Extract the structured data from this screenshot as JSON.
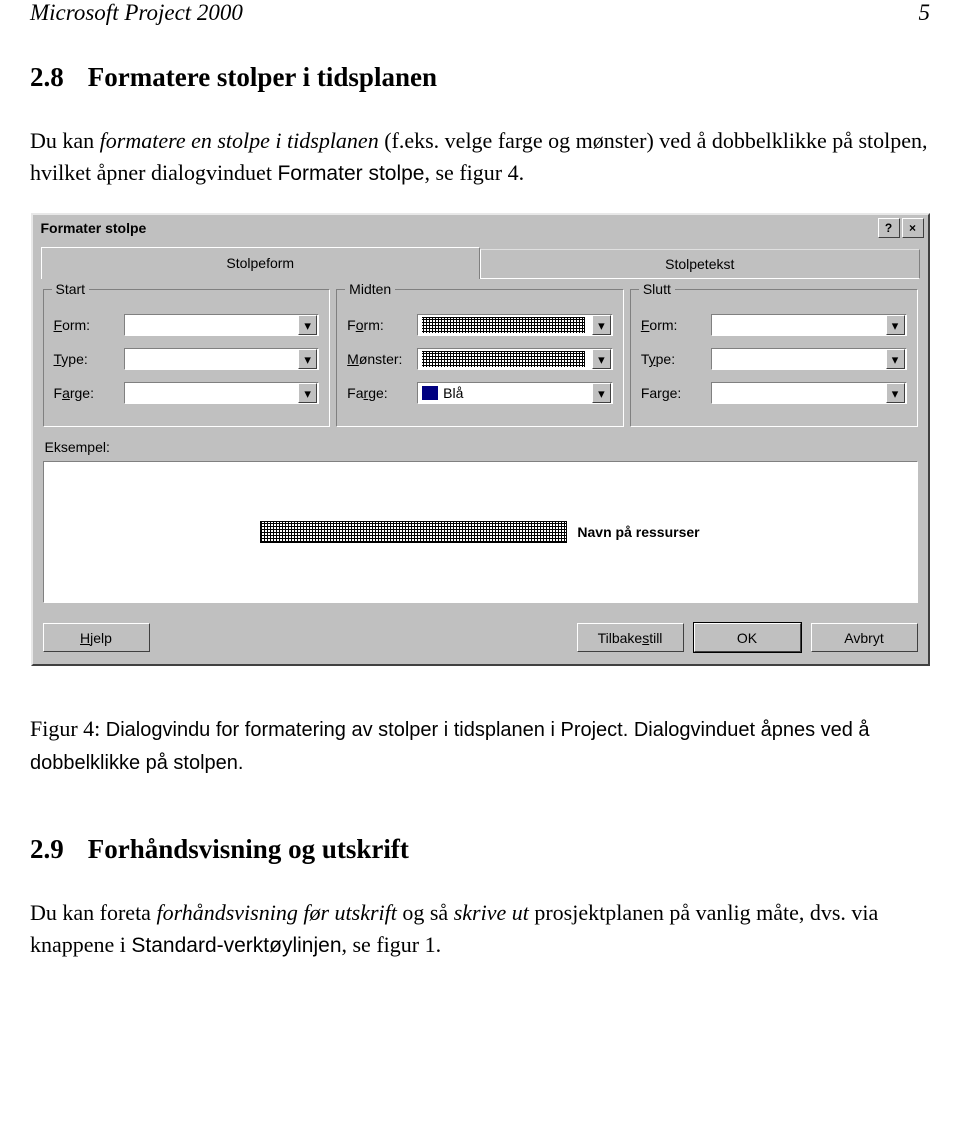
{
  "header": {
    "left": "Microsoft Project 2000",
    "right": "5"
  },
  "sec1": {
    "num": "2.8",
    "title": "Formatere stolper i tidsplanen",
    "para_a": "Du kan ",
    "para_b": "formatere en stolpe i tidsplanen",
    "para_c": " (f.eks. velge farge og mønster) ved å dobbelklikke på stolpen, hvilket åpner dialogvinduet ",
    "para_d": "Formater stolpe",
    "para_e": ", se figur 4."
  },
  "dialog": {
    "title": "Formater stolpe",
    "help": "?",
    "close": "×",
    "tab1": "Stolpeform",
    "tab2": "Stolpetekst",
    "group_start": "Start",
    "group_mid": "Midten",
    "group_end": "Slutt",
    "form": "Form:",
    "type": "Type:",
    "monster": "Mønster:",
    "farge": "Farge:",
    "farge_value": "Blå",
    "example": "Eksempel:",
    "example_text": "Navn på ressurser",
    "btn_help": "Hjelp",
    "btn_reset": "Tilbakestill",
    "btn_ok": "OK",
    "btn_cancel": "Avbryt"
  },
  "figcaption": {
    "a": "Figur 4: ",
    "b": "Dialogvindu for formatering av stolper i tidsplanen i Project. Dialogvinduet åpnes ved å dobbelklikke på stolpen."
  },
  "sec2": {
    "num": "2.9",
    "title": "Forhåndsvisning og utskrift",
    "para_a": "Du kan foreta ",
    "para_b": "forhåndsvisning før utskrift",
    "para_c": " og så ",
    "para_d": "skrive ut",
    "para_e": " prosjektplanen på vanlig måte, dvs. via knappene i ",
    "para_f": "Standard-verktøylinjen",
    "para_g": ", se figur 1."
  }
}
